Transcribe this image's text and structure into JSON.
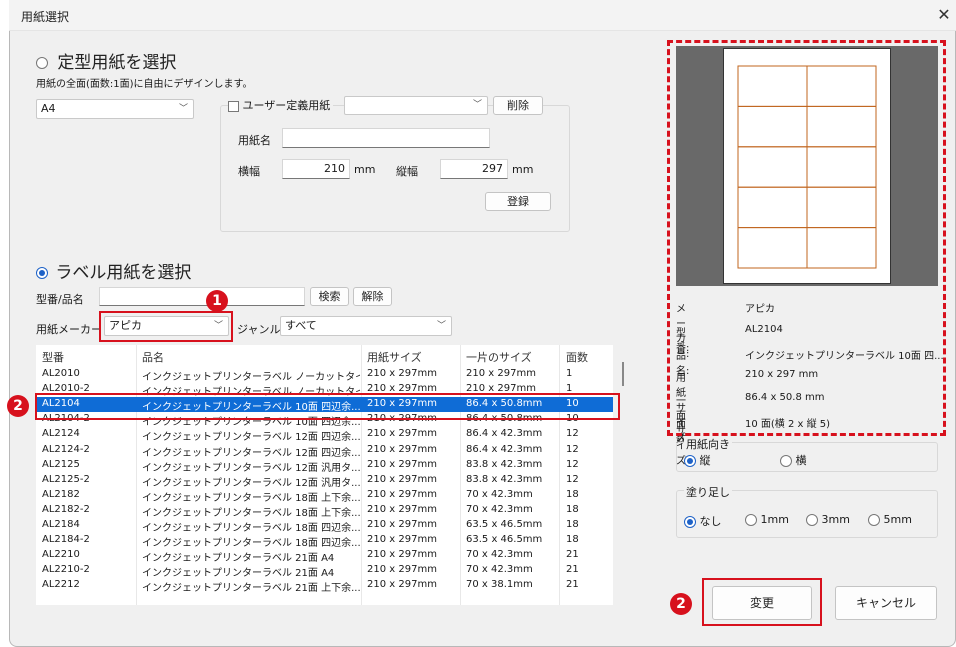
{
  "window": {
    "title": "用紙選択",
    "close_glyph": "✕"
  },
  "standard": {
    "radio_label": "定型用紙を選択",
    "description": "用紙の全面(面数:1面)に自由にデザインします。",
    "paper_size": "A4",
    "user_defined_label": "ユーザー定義用紙",
    "user_defined_value": "",
    "delete_label": "削除",
    "paper_name_label": "用紙名",
    "paper_name_value": "",
    "width_label": "横幅",
    "width_value": "210",
    "height_label": "縦幅",
    "height_value": "297",
    "unit": "mm",
    "register_label": "登録"
  },
  "label": {
    "radio_label": "ラベル用紙を選択",
    "model_label": "型番/品名",
    "model_value": "",
    "search_label": "検索",
    "clear_label": "解除",
    "maker_label": "用紙メーカー",
    "maker_value": "アピカ",
    "genre_label": "ジャンル",
    "genre_value": "すべて"
  },
  "table": {
    "headers": [
      "型番",
      "品名",
      "用紙サイズ",
      "一片のサイズ",
      "面数"
    ],
    "rows": [
      [
        "AL2010",
        "インクジェットプリンターラベル ノーカットタイプ...",
        "210 x 297mm",
        "210 x 297mm",
        "1"
      ],
      [
        "AL2010-2",
        "インクジェットプリンターラベル ノーカットタイプ...",
        "210 x 297mm",
        "210 x 297mm",
        "1"
      ],
      [
        "AL2104",
        "インクジェットプリンターラベル 10面 四辺余...",
        "210 x 297mm",
        "86.4 x 50.8mm",
        "10"
      ],
      [
        "AL2104-2",
        "インクジェットプリンターラベル 10面 四辺余...",
        "210 x 297mm",
        "86.4 x 50.8mm",
        "10"
      ],
      [
        "AL2124",
        "インクジェットプリンターラベル 12面 四辺余...",
        "210 x 297mm",
        "86.4 x 42.3mm",
        "12"
      ],
      [
        "AL2124-2",
        "インクジェットプリンターラベル 12面 四辺余...",
        "210 x 297mm",
        "86.4 x 42.3mm",
        "12"
      ],
      [
        "AL2125",
        "インクジェットプリンターラベル 12面 汎用タ...",
        "210 x 297mm",
        "83.8 x 42.3mm",
        "12"
      ],
      [
        "AL2125-2",
        "インクジェットプリンターラベル 12面 汎用タ...",
        "210 x 297mm",
        "83.8 x 42.3mm",
        "12"
      ],
      [
        "AL2182",
        "インクジェットプリンターラベル 18面 上下余...",
        "210 x 297mm",
        "70 x 42.3mm",
        "18"
      ],
      [
        "AL2182-2",
        "インクジェットプリンターラベル 18面 上下余...",
        "210 x 297mm",
        "70 x 42.3mm",
        "18"
      ],
      [
        "AL2184",
        "インクジェットプリンターラベル 18面 四辺余...",
        "210 x 297mm",
        "63.5 x 46.5mm",
        "18"
      ],
      [
        "AL2184-2",
        "インクジェットプリンターラベル 18面 四辺余...",
        "210 x 297mm",
        "63.5 x 46.5mm",
        "18"
      ],
      [
        "AL2210",
        "インクジェットプリンターラベル 21面 A4",
        "210 x 297mm",
        "70 x 42.3mm",
        "21"
      ],
      [
        "AL2210-2",
        "インクジェットプリンターラベル 21面 A4",
        "210 x 297mm",
        "70 x 42.3mm",
        "21"
      ],
      [
        "AL2212",
        "インクジェットプリンターラベル 21面 上下余...",
        "210 x 297mm",
        "70 x 38.1mm",
        "21"
      ]
    ],
    "selected_row": 2
  },
  "info": {
    "maker_key": "メーカー:",
    "maker_val": "アピカ",
    "model_key": "型番:",
    "model_val": "AL2104",
    "name_key": "品名:",
    "name_val": "インクジェットプリンターラベル 10面 四...",
    "paper_size_key": "用紙サイズ:",
    "paper_size_val": "210 x 297 mm",
    "piece_size_key": "一面サイズ:",
    "piece_size_val": "86.4 x 50.8 mm",
    "faces_key": "面数:",
    "faces_val": "10 面(横 2 x 縦 5)"
  },
  "orientation": {
    "label": "用紙向き",
    "portrait": "縦",
    "landscape": "横"
  },
  "bleed": {
    "label": "塗り足し",
    "none": "なし",
    "opt1": "1mm",
    "opt3": "3mm",
    "opt5": "5mm"
  },
  "buttons": {
    "ok": "変更",
    "cancel": "キャンセル"
  },
  "annotations": {
    "badge1": "❶",
    "badge2": "❷"
  },
  "colors": {
    "accent": "#0f6cd6",
    "annotation_red": "#d7111d",
    "label_line": "#c0651e"
  }
}
